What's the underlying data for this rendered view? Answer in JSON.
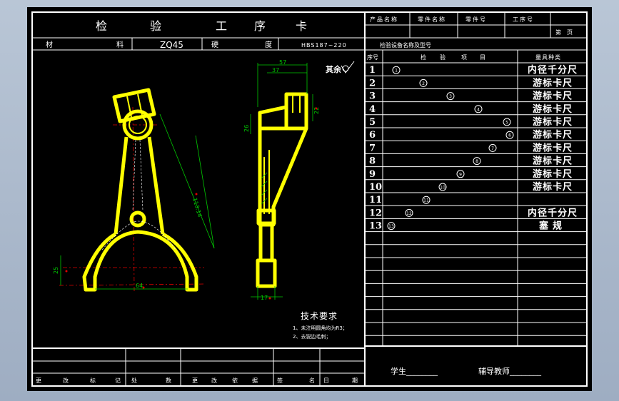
{
  "header": {
    "title_chars": [
      "检",
      "验",
      "工",
      "序",
      "卡"
    ],
    "product_name_label": "产品名称",
    "part_name_label": "零件名称",
    "part_no_label": "零件号",
    "process_no_label": "工序号",
    "page_label": "第　页"
  },
  "material_row": {
    "material_label_1": "材",
    "material_label_2": "料",
    "material_value": "ZQ45",
    "hardness_label_1": "硬",
    "hardness_label_2": "度",
    "hardness_value": "HBS187~220"
  },
  "inspection_equipment_label": "检验设备名称及型号",
  "inspection_table": {
    "headers": {
      "no": "序号",
      "item_1": "检",
      "item_2": "验",
      "item_3": "项",
      "item_4": "目",
      "tool": "量具种类"
    },
    "rows": [
      {
        "no": "1",
        "item": "①",
        "tool": "内径千分尺"
      },
      {
        "no": "2",
        "item": "②",
        "tool": "游标卡尺"
      },
      {
        "no": "3",
        "item": "③",
        "tool": "游标卡尺"
      },
      {
        "no": "4",
        "item": "④",
        "tool": "游标卡尺"
      },
      {
        "no": "5",
        "item": "⑤",
        "tool": "游标卡尺"
      },
      {
        "no": "6",
        "item": "⑥",
        "tool": "游标卡尺"
      },
      {
        "no": "7",
        "item": "⑦",
        "tool": "游标卡尺"
      },
      {
        "no": "8",
        "item": "⑧",
        "tool": "游标卡尺"
      },
      {
        "no": "9",
        "item": "⑨",
        "tool": "游标卡尺"
      },
      {
        "no": "10",
        "item": "⑩",
        "tool": "游标卡尺"
      },
      {
        "no": "11",
        "item": "⑪",
        "tool": "",
        "item_small": "11"
      },
      {
        "no": "12",
        "item": "⑫",
        "tool": "内径千分尺"
      },
      {
        "no": "13",
        "item": "⑬",
        "tool": "塞规"
      }
    ]
  },
  "drawing": {
    "surface_mark": "其余",
    "dims": [
      "57",
      "37",
      "22",
      "26",
      "113.14",
      "25",
      "64",
      "17"
    ],
    "tech_title": "技术要求",
    "tech_notes": [
      "1、未注明圆角均为R3；",
      "2、去锐边毛刺；"
    ]
  },
  "footer": {
    "labels": [
      "更",
      "改",
      "标",
      "记",
      "处",
      "数",
      "更",
      "改",
      "依",
      "据",
      "签",
      "名",
      "日",
      "期"
    ],
    "student_label": "学生________",
    "teacher_label": "辅导教师________"
  },
  "colors": {
    "part_outline": "#ffff00",
    "dimension": "#00c800",
    "centerline": "#e00000",
    "grid": "#ffffff",
    "background": "#000000"
  }
}
